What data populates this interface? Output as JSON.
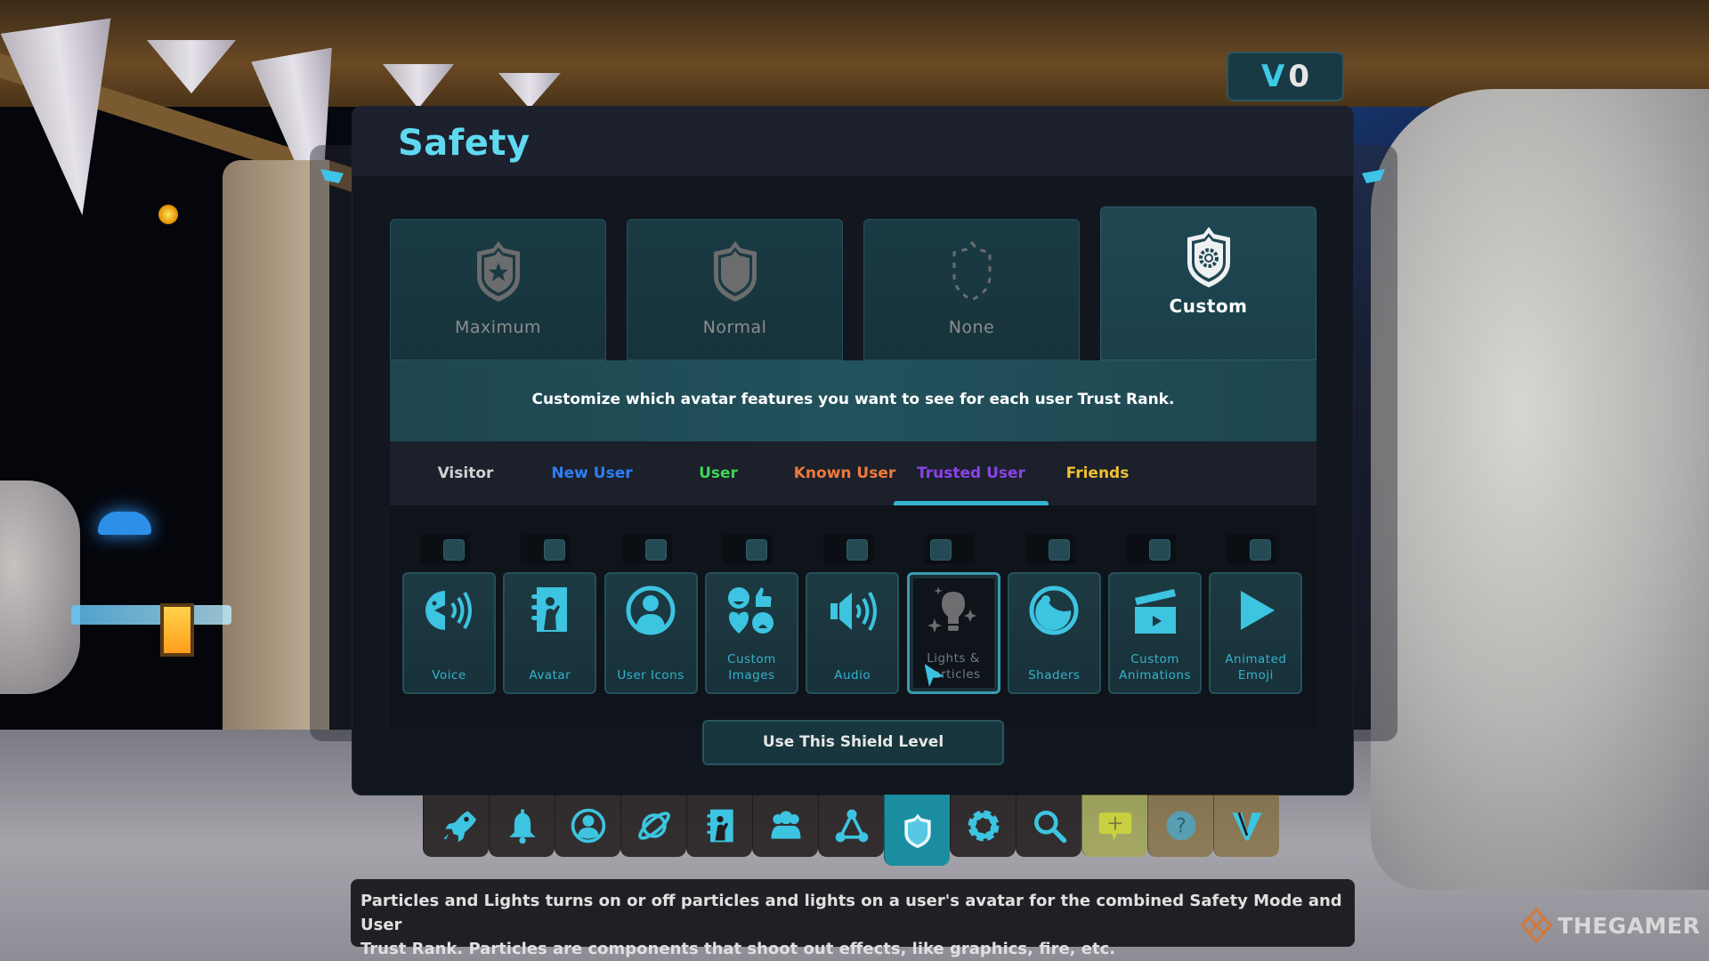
{
  "currency": {
    "symbol": "V",
    "amount": "0"
  },
  "panel": {
    "title": "Safety",
    "presets": [
      {
        "label": "Maximum",
        "icon": "shield-star-icon",
        "active": false
      },
      {
        "label": "Normal",
        "icon": "shield-icon",
        "active": false
      },
      {
        "label": "None",
        "icon": "shield-dashed-icon",
        "active": false
      },
      {
        "label": "Custom",
        "icon": "shield-gear-icon",
        "active": true
      }
    ],
    "info_text": "Customize which avatar features you want to see for each user Trust Rank.",
    "tabs": [
      {
        "label": "Visitor",
        "color": "#d0d0d0"
      },
      {
        "label": "New User",
        "color": "#2f7ff0"
      },
      {
        "label": "User",
        "color": "#3fd45a"
      },
      {
        "label": "Known User",
        "color": "#f07a3a"
      },
      {
        "label": "Trusted User",
        "color": "#8a44e6"
      },
      {
        "label": "Friends",
        "color": "#f0c030"
      }
    ],
    "active_tab": "Trusted User",
    "features": [
      {
        "label": "Voice",
        "icon": "voice-icon",
        "enabled": true
      },
      {
        "label": "Avatar",
        "icon": "avatar-icon",
        "enabled": true
      },
      {
        "label": "User Icons",
        "icon": "user-icon",
        "enabled": true
      },
      {
        "label": "Custom\nImages",
        "icon": "custom-images-icon",
        "enabled": true
      },
      {
        "label": "Audio",
        "icon": "audio-icon",
        "enabled": true
      },
      {
        "label": "Lights &\nParticles",
        "icon": "lightbulb-icon",
        "enabled": false
      },
      {
        "label": "Shaders",
        "icon": "shaders-icon",
        "enabled": true
      },
      {
        "label": "Custom\nAnimations",
        "icon": "clapperboard-icon",
        "enabled": true
      },
      {
        "label": "Animated\nEmoji",
        "icon": "play-icon",
        "enabled": true
      }
    ],
    "apply_button": "Use This Shield Level"
  },
  "nav": [
    {
      "name": "launch",
      "icon": "rocket-icon"
    },
    {
      "name": "notifications",
      "icon": "bell-icon"
    },
    {
      "name": "profile",
      "icon": "user-circle-icon"
    },
    {
      "name": "worlds",
      "icon": "planet-icon"
    },
    {
      "name": "avatars",
      "icon": "avatar-book-icon"
    },
    {
      "name": "social",
      "icon": "group-icon"
    },
    {
      "name": "network",
      "icon": "network-icon"
    },
    {
      "name": "safety",
      "icon": "shield-icon",
      "active": true
    },
    {
      "name": "settings",
      "icon": "gear-icon"
    },
    {
      "name": "search",
      "icon": "search-icon"
    },
    {
      "name": "chat",
      "icon": "chat-plus-icon"
    },
    {
      "name": "help",
      "icon": "help-icon"
    },
    {
      "name": "vrchat-plus",
      "icon": "v-logo-icon"
    }
  ],
  "tooltip": {
    "line1": "Particles and Lights turns on or off particles and lights on a user's avatar for the combined Safety Mode and User",
    "line2": "Trust Rank. Particles are components that shoot out effects, like graphics, fire, etc."
  },
  "watermark": "THEGAMER",
  "colors": {
    "accent": "#33b6d2",
    "title": "#5fd9f0",
    "feature": "#33b3cc"
  }
}
